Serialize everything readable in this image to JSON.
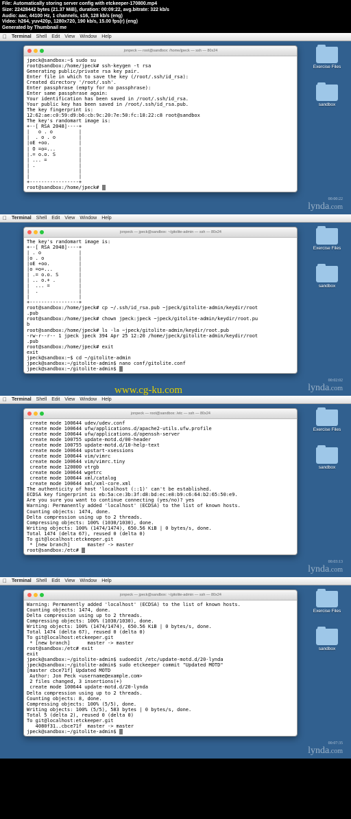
{
  "header": {
    "l1": "File: Automatically storing server config with etckeeper-170800.mp4",
    "l2": "Size: 22428442 bytes (21.37 MiB), duration: 00:09:22, avg.bitrate: 322 kb/s",
    "l3": "Audio: aac, 44100 Hz, 1 channels, s16, 128 kb/s (eng)",
    "l4": "Video: h264, yuv420p, 1280x720, 190 kb/s, 15.00 fps(r) (eng)",
    "l5": "Generated by Thumbnail me"
  },
  "menubar": {
    "apple": "",
    "app": "Terminal",
    "m1": "Shell",
    "m2": "Edit",
    "m3": "View",
    "m4": "Window",
    "m5": "Help"
  },
  "folders": {
    "f1": "Exercise Files",
    "f2": "sandbox"
  },
  "lynda": {
    "brand": "lynda",
    "com": ".com"
  },
  "ts": {
    "t1": "00:00:22",
    "t2": "00:02:02",
    "t3": "00:03:13",
    "t4": "00:07:35"
  },
  "titles": {
    "w1": "jonpeck — root@sandbox: /home/jpeck — ssh — 80x24",
    "w2": "jonpeck — jpeck@sandbox: ~/gitolite-admin — ssh — 80x24",
    "w3": "jonpeck — root@sandbox: /etc — ssh — 80x24",
    "w4": "jonpeck — jpeck@sandbox: ~/gitolite-admin — ssh — 80x24"
  },
  "term1": "jpeck@sandbox:~$ sudo su\nroot@sandbox:/home/jpeck# ssh-keygen -t rsa\nGenerating public/private rsa key pair.\nEnter file in which to save the key (/root/.ssh/id_rsa):\nCreated directory '/root/.ssh'.\nEnter passphrase (empty for no passphrase):\nEnter same passphrase again:\nYour identification has been saved in /root/.ssh/id_rsa.\nYour public key has been saved in /root/.ssh/id_rsa.pub.\nThe key fingerprint is:\n12:62:ae:c0:59:d9:b6:cb:9c:20:7e:50:fc:18:22:c8 root@sandbox\nThe key's randomart image is:\n+--[ RSA 2048]----+\n|   o . o         |\n|  . o . o        |\n|oE +oo.          |\n| O =o=...        |\n|.= o.o. S        |\n| ... =           |\n| .               |\n|                 |\n|                 |\n+-----------------+\nroot@sandbox:/home/jpeck# ",
  "term2": "The key's randomart image is:\n+--[ RSA 2048]----+\n| . o             |\n|o . o            |\n|oE +oo.          |\n|o =o=...         |\n| .= o.o. S       |\n| .. o.+ .        |\n|  ... =          |\n|  .              |\n|                 |\n+-----------------+\nroot@sandbox:/home/jpeck# cp ~/.ssh/id_rsa.pub ~jpeck/gitolite-admin/keydir/root\n.pub\nroot@sandbox:/home/jpeck# chown jpeck:jpeck ~jpeck/gitolite-admin/keydir/root.pu\nb\nroot@sandbox:/home/jpeck# ls -la ~jpeck/gitolite-admin/keydir/root.pub\n-rw-r--r-- 1 jpeck jpeck 394 Apr 25 12:20 /home/jpeck/gitolite-admin/keydir/root\n.pub\nroot@sandbox:/home/jpeck# exit\nexit\njpeck@sandbox:~$ cd ~/gitolite-admin\njpeck@sandbox:~/gitolite-admin$ nano conf/gitolite.conf\njpeck@sandbox:~/gitolite-admin$ ",
  "term3": " create mode 100644 udev/udev.conf\n create mode 100644 ufw/applications.d/apache2-utils.ufw.profile\n create mode 100644 ufw/applications.d/openssh-server\n create mode 100755 update-motd.d/00-header\n create mode 100755 update-motd.d/10-help-text\n create mode 100644 upstart-xsessions\n create mode 100644 vim/vimrc\n create mode 100644 vim/vimrc.tiny\n create mode 120000 vtrgb\n create mode 100644 wgetrc\n create mode 100644 xml/catalog\n create mode 100644 xml/xml-core.xml\nThe authenticity of host 'localhost (::1)' can't be established.\nECDSA key fingerprint is eb:5a:ce:3b:3f:d8:bd:ec:e8:b9:c6:64:b2:65:50:e9.\nAre you sure you want to continue connecting (yes/no)? yes\nWarning: Permanently added 'localhost' (ECDSA) to the list of known hosts.\nCounting objects: 1474, done.\nDelta compression using up to 2 threads.\nCompressing objects: 100% (1030/1030), done.\nWriting objects: 100% (1474/1474), 650.56 KiB | 0 bytes/s, done.\nTotal 1474 (delta 67), reused 0 (delta 0)\nTo git@localhost:etckeeper.git\n * [new branch]      master -> master\nroot@sandbox:/etc# ",
  "term4": "Warning: Permanently added 'localhost' (ECDSA) to the list of known hosts.\nCounting objects: 1474, done.\nDelta compression using up to 2 threads.\nCompressing objects: 100% (1030/1030), done.\nWriting objects: 100% (1474/1474), 650.56 KiB | 0 bytes/s, done.\nTotal 1474 (delta 67), reused 0 (delta 0)\nTo git@localhost:etckeeper.git\n * [new branch]      master -> master\nroot@sandbox:/etc# exit\nexit\njpeck@sandbox:~/gitolite-admin$ sudoedit /etc/update-motd.d/20-lynda\njpeck@sandbox:~/gitolite-admin$ sudo etckeeper commit \"Updated MOTD\"\n[master cbce71f] Updated MOTD\n Author: Jon Peck <username@example.com>\n 2 files changed, 3 insertions(+)\n create mode 100644 update-motd.d/20-lynda\nDelta compression using up to 2 threads.\nCounting objects: 8, done.\nCompressing objects: 100% (5/5), done.\nWriting objects: 100% (5/5), 583 bytes | 0 bytes/s, done.\nTotal 5 (delta 2), reused 0 (delta 0)\nTo git@localhost:etckeeper.git\n   4080f31..cbce71f  master -> master\njpeck@sandbox:~/gitolite-admin$ ",
  "watermark": "www.cg-ku.com"
}
